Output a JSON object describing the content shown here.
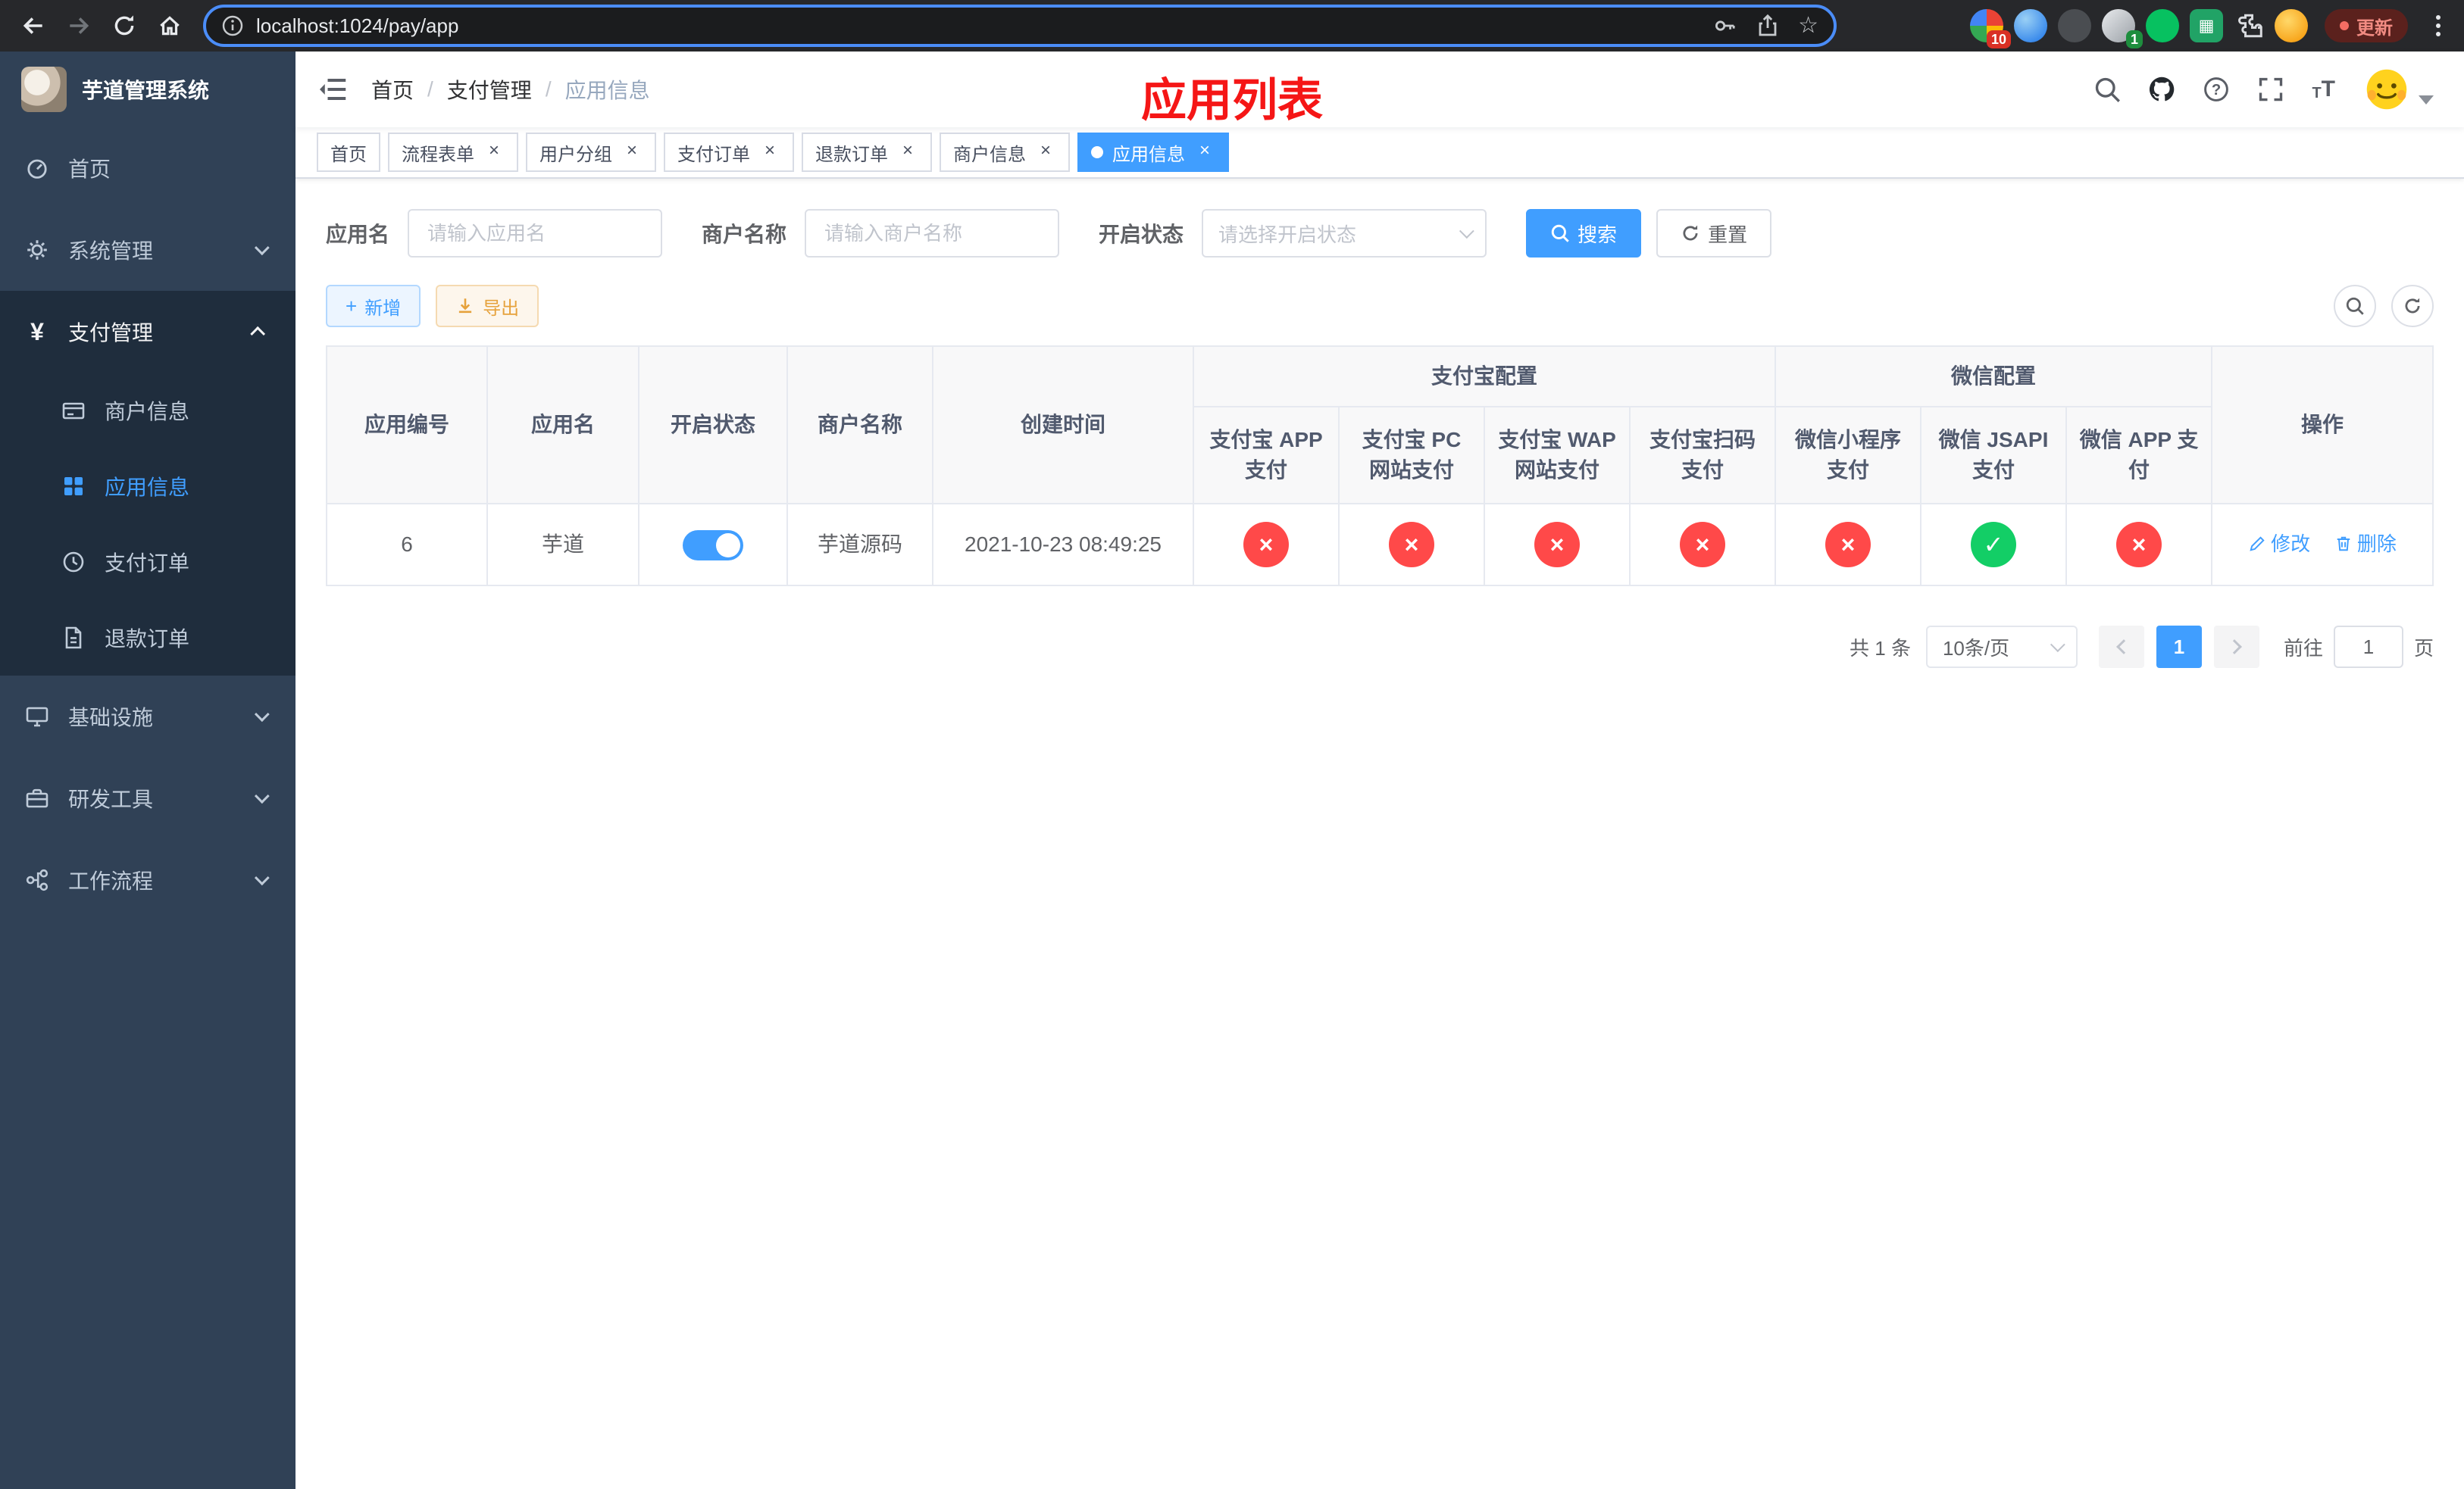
{
  "colors": {
    "accent_blue": "#409eff",
    "success_green": "#13ce66",
    "danger_red": "#ff4949",
    "warning_orange": "#e6a23c",
    "watermark_red": "#f51616",
    "sidebar_bg": "#304156",
    "sidebar_submenu_bg": "#1f2d3d"
  },
  "icons": {
    "check": "✓",
    "cross": "×",
    "yen": "¥",
    "star": "☆",
    "plus": "+",
    "close": "×",
    "font_small": "T",
    "font_big": "T"
  },
  "browser": {
    "url": "localhost:1024/pay/app",
    "update_button": "更新",
    "extension_badge_a": "10",
    "extension_badge_b": "1"
  },
  "sidebar": {
    "logo_title": "芋道管理系统",
    "items": [
      {
        "label": "首页"
      },
      {
        "label": "系统管理"
      },
      {
        "label": "支付管理"
      },
      {
        "label": "基础设施"
      },
      {
        "label": "研发工具"
      },
      {
        "label": "工作流程"
      }
    ],
    "pay_children": [
      {
        "label": "商户信息"
      },
      {
        "label": "应用信息"
      },
      {
        "label": "支付订单"
      },
      {
        "label": "退款订单"
      }
    ]
  },
  "header": {
    "breadcrumb": [
      "首页",
      "支付管理",
      "应用信息"
    ],
    "watermark": "应用列表"
  },
  "tags": [
    {
      "label": "首页",
      "closable": false,
      "active": false
    },
    {
      "label": "流程表单",
      "closable": true,
      "active": false
    },
    {
      "label": "用户分组",
      "closable": true,
      "active": false
    },
    {
      "label": "支付订单",
      "closable": true,
      "active": false
    },
    {
      "label": "退款订单",
      "closable": true,
      "active": false
    },
    {
      "label": "商户信息",
      "closable": true,
      "active": false
    },
    {
      "label": "应用信息",
      "closable": true,
      "active": true
    }
  ],
  "filter": {
    "app_name_label": "应用名",
    "app_name_placeholder": "请输入应用名",
    "app_name_value": "",
    "merchant_label": "商户名称",
    "merchant_placeholder": "请输入商户名称",
    "merchant_value": "",
    "status_label": "开启状态",
    "status_placeholder": "请选择开启状态",
    "status_value": "",
    "search": "搜索",
    "reset": "重置"
  },
  "toolbar": {
    "add": "新增",
    "export": "导出"
  },
  "table": {
    "col_app_id": "应用编号",
    "col_app_name": "应用名",
    "col_status": "开启状态",
    "col_merchant": "商户名称",
    "col_created": "创建时间",
    "group_alipay": "支付宝配置",
    "group_wechat": "微信配置",
    "col_op": "操作",
    "col_alipay_app": "支付宝 APP 支付",
    "col_alipay_pc": "支付宝 PC 网站支付",
    "col_alipay_wap": "支付宝 WAP 网站支付",
    "col_alipay_qr": "支付宝扫码支付",
    "col_wx_mini": "微信小程序支付",
    "col_wx_jsapi": "微信 JSAPI 支付",
    "col_wx_app": "微信 APP 支付",
    "rows": [
      {
        "app_id": "6",
        "app_name": "芋道",
        "enabled": true,
        "merchant": "芋道源码",
        "created": "2021-10-23 08:49:25",
        "alipay_app": false,
        "alipay_pc": false,
        "alipay_wap": false,
        "alipay_qr": false,
        "wx_mini": false,
        "wx_jsapi": true,
        "wx_app": false,
        "edit": "修改",
        "delete": "删除"
      }
    ]
  },
  "pagination": {
    "total": "共 1 条",
    "page_size": "10条/页",
    "page": "1",
    "goto_prefix": "前往",
    "goto_value": "1",
    "goto_suffix": "页"
  }
}
